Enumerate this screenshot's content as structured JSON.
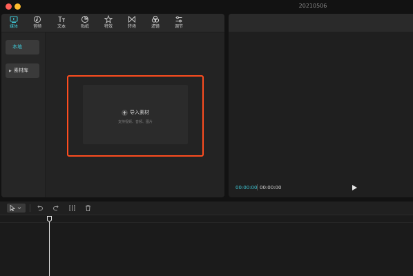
{
  "window": {
    "title": "20210506"
  },
  "toolbar": {
    "tabs": [
      {
        "label": "媒体",
        "icon": "media-icon",
        "active": true
      },
      {
        "label": "音频",
        "icon": "audio-icon"
      },
      {
        "label": "文本",
        "icon": "text-icon"
      },
      {
        "label": "贴纸",
        "icon": "sticker-icon"
      },
      {
        "label": "特效",
        "icon": "effects-icon"
      },
      {
        "label": "转场",
        "icon": "transition-icon"
      },
      {
        "label": "滤镜",
        "icon": "filter-icon"
      },
      {
        "label": "调节",
        "icon": "adjust-icon"
      }
    ]
  },
  "sidebar": {
    "items": [
      {
        "label": "本地",
        "active": true
      },
      {
        "label": "素材库"
      }
    ]
  },
  "import": {
    "title": "导入素材",
    "subtitle": "支持视频、音频、图片"
  },
  "player": {
    "current_time": "00:00:00",
    "total_time": "00:00:00"
  },
  "timeline": {
    "tools": [
      "select-tool-icon",
      "undo-icon",
      "redo-icon",
      "split-icon",
      "delete-icon"
    ]
  },
  "colors": {
    "accent": "#3fc9d8",
    "highlight_border": "#ff4d1f",
    "background": "#121212"
  }
}
